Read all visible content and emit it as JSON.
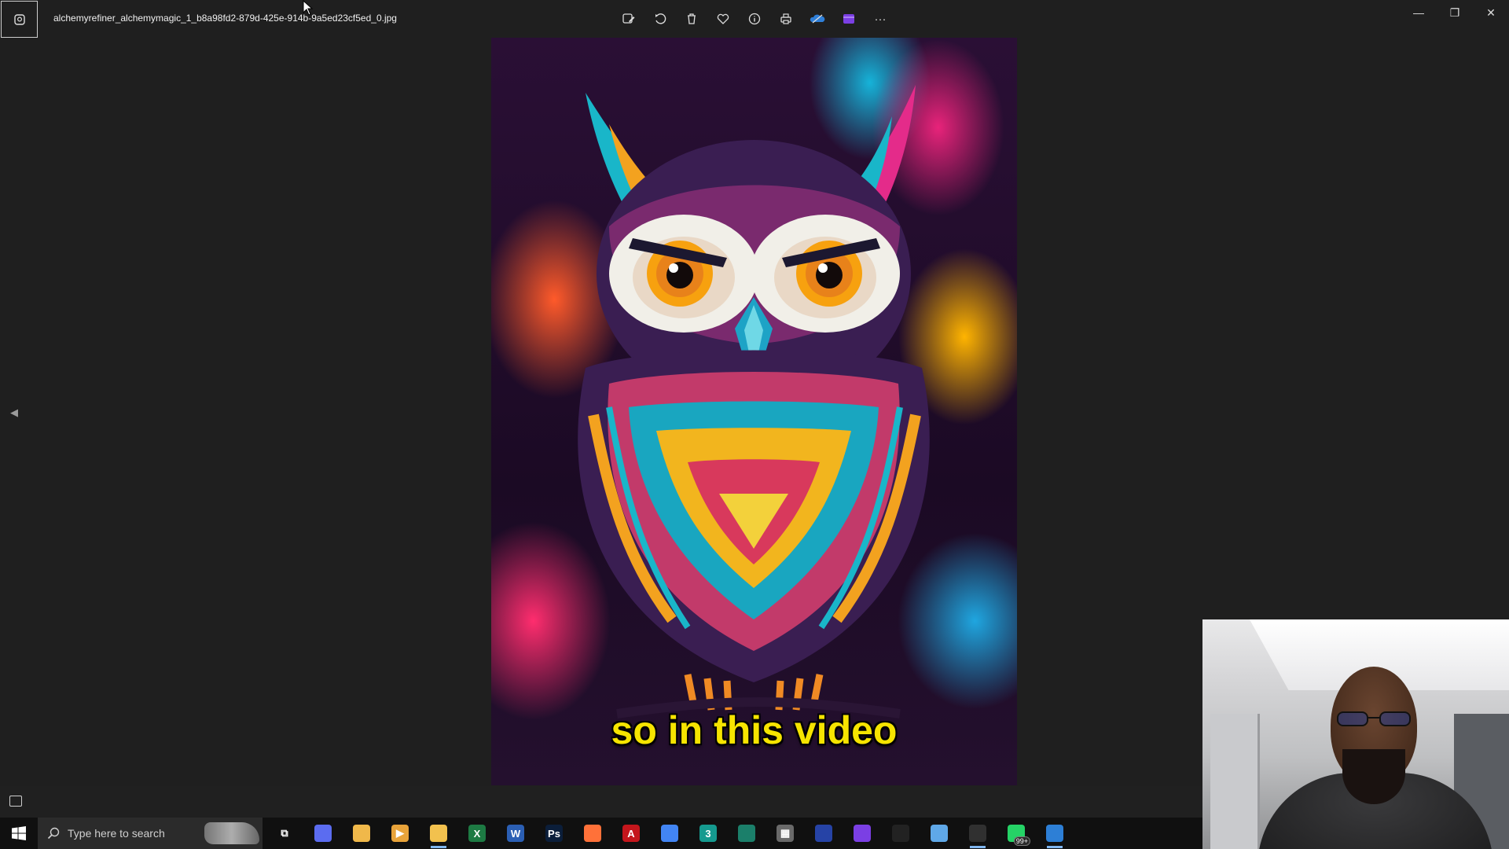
{
  "titlebar": {
    "file_name": "alchemyrefiner_alchemymagic_1_b8a98fd2-879d-425e-914b-9a5ed23cf5ed_0.jpg"
  },
  "toolbar": {
    "icons": [
      "edit-image-icon",
      "rotate-icon",
      "delete-icon",
      "favorite-icon",
      "info-icon",
      "print-icon",
      "onedrive-icon",
      "clipchamp-icon",
      "more-icon"
    ],
    "more_label": "···"
  },
  "window_controls": {
    "minimize": "—",
    "restore": "❐",
    "close": "✕"
  },
  "viewer": {
    "caption": "so in this video",
    "image_subject": "colorful owl illustration"
  },
  "taskbar": {
    "search_placeholder": "Type here to search",
    "apps": [
      {
        "name": "task-view",
        "glyph": "⧉",
        "color": "#101010"
      },
      {
        "name": "copilot",
        "glyph": "",
        "color": "#5b6cf0"
      },
      {
        "name": "paint",
        "glyph": "",
        "color": "#f0b84a"
      },
      {
        "name": "media-player",
        "glyph": "▶",
        "color": "#e8a33a"
      },
      {
        "name": "file-explorer",
        "glyph": "",
        "color": "#f2c14e",
        "active": true
      },
      {
        "name": "excel",
        "glyph": "X",
        "color": "#1d7a43"
      },
      {
        "name": "word",
        "glyph": "W",
        "color": "#2b5fb4"
      },
      {
        "name": "photoshop",
        "glyph": "Ps",
        "color": "#0b1e3a"
      },
      {
        "name": "firefox",
        "glyph": "",
        "color": "#ff7139"
      },
      {
        "name": "acrobat",
        "glyph": "A",
        "color": "#c4161c"
      },
      {
        "name": "chrome",
        "glyph": "",
        "color": "#4285f4"
      },
      {
        "name": "app-3",
        "glyph": "3",
        "color": "#159a8f"
      },
      {
        "name": "app-green",
        "glyph": "",
        "color": "#1b7f6a"
      },
      {
        "name": "calculator",
        "glyph": "▦",
        "color": "#6a6a6a"
      },
      {
        "name": "app-blue-hat",
        "glyph": "",
        "color": "#2643a6"
      },
      {
        "name": "clipchamp",
        "glyph": "",
        "color": "#7b3fe4"
      },
      {
        "name": "capcut",
        "glyph": "",
        "color": "#222"
      },
      {
        "name": "notepad",
        "glyph": "",
        "color": "#5fa8e8"
      },
      {
        "name": "capcut-active",
        "glyph": "",
        "color": "#303030",
        "active": true
      },
      {
        "name": "whatsapp",
        "glyph": "",
        "color": "#25d366",
        "badge": "99+"
      },
      {
        "name": "photos",
        "glyph": "",
        "color": "#2d7fd6",
        "active": true
      },
      {
        "name": "clock-app",
        "glyph": "",
        "color": "#101010"
      }
    ],
    "tray": [
      "help-icon",
      "notification-app-icon"
    ]
  },
  "colors": {
    "background": "#1f1f1f",
    "caption": "#f6e400",
    "taskbar": "#101010"
  }
}
